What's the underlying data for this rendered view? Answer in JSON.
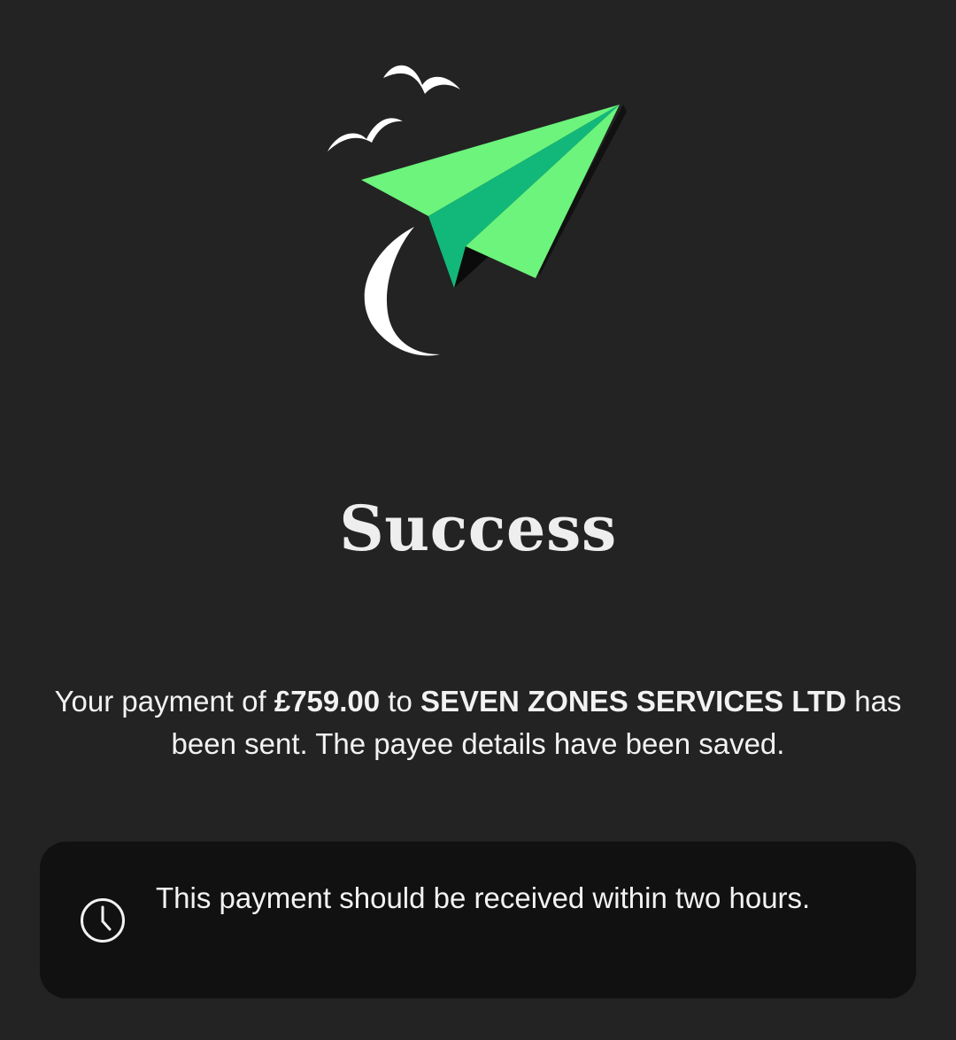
{
  "header": {
    "title": "Success"
  },
  "message": {
    "prefix": "Your payment of ",
    "amount": "£759.00",
    "to_word": " to ",
    "payee": "SEVEN ZONES SERVICES LTD",
    "suffix": " has been sent. The payee details have been saved."
  },
  "info": {
    "icon": "clock-icon",
    "text": "This payment should be received within two hours."
  },
  "colors": {
    "background": "#232323",
    "card_background": "#111111",
    "plane_light_green": "#6cf47c",
    "plane_dark_green": "#12b87a",
    "text": "#f2f2f2"
  }
}
